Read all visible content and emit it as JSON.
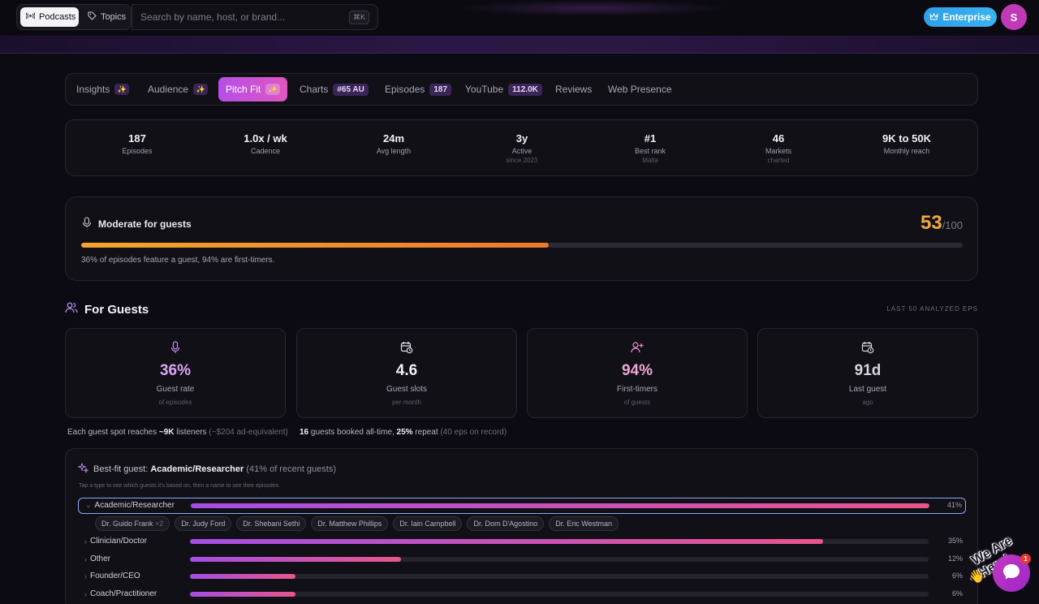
{
  "topbar": {
    "podcasts_label": "Podcasts",
    "topics_label": "Topics",
    "search_placeholder": "Search by name, host, or brand...",
    "search_shortcut": "⌘K",
    "enterprise_label": "Enterprise",
    "avatar_initial": "S"
  },
  "tabs": [
    {
      "label": "Insights",
      "spark": "✨"
    },
    {
      "label": "Audience",
      "spark": "✨"
    },
    {
      "label": "Pitch Fit",
      "spark": "✨"
    },
    {
      "label": "Charts",
      "badge": "#65 AU"
    },
    {
      "label": "Episodes",
      "badge": "187"
    },
    {
      "label": "YouTube",
      "badge": "112.0K"
    },
    {
      "label": "Reviews"
    },
    {
      "label": "Web Presence"
    }
  ],
  "stats": [
    {
      "value": "187",
      "label": "Episodes",
      "sub": ""
    },
    {
      "value": "1.0x / wk",
      "label": "Cadence",
      "sub": ""
    },
    {
      "value": "24m",
      "label": "Avg length",
      "sub": ""
    },
    {
      "value": "3y",
      "label": "Active",
      "sub": "since 2023"
    },
    {
      "value": "#1",
      "label": "Best rank",
      "sub": "Malta"
    },
    {
      "value": "46",
      "label": "Markets",
      "sub": "charted"
    },
    {
      "value": "9K to 50K",
      "label": "Monthly reach",
      "sub": ""
    }
  ],
  "score": {
    "title": "Moderate for guests",
    "value": "53",
    "max": "/100",
    "fraction": 0.53,
    "note": "36% of episodes feature a guest, 94% are first-timers."
  },
  "guests": {
    "title": "For Guests",
    "right_label": "LAST 50 ANALYZED EPS",
    "cards": [
      {
        "value": "36%",
        "label": "Guest rate",
        "sub": "of episodes",
        "color": "#d9a7f2"
      },
      {
        "value": "4.6",
        "label": "Guest slots",
        "sub": "per month",
        "color": "#f2f1f6"
      },
      {
        "value": "94%",
        "label": "First-timers",
        "sub": "of guests",
        "color": "#eea6d6"
      },
      {
        "value": "91d",
        "label": "Last guest",
        "sub": "ago",
        "color": "#d6d4dd"
      }
    ],
    "note_left": {
      "a": "Each guest spot reaches ",
      "b": "~9K",
      "c": " listeners ",
      "d": "(~$204 ad-equivalent)"
    },
    "note_right": {
      "a": "16",
      "b": " guests booked all-time, ",
      "c": "25%",
      "d": " repeat ",
      "e": "(40 eps on record)"
    }
  },
  "bestfit": {
    "prefix": "Best-fit guest: ",
    "type": "Academic/Researcher",
    "suffix": " (41% of recent guests)",
    "hint": "Tap a type to see which guests it's based on, then a name to see their episodes.",
    "rows": [
      {
        "label": "Academic/Researcher",
        "pct_text": "41%",
        "fraction": 1.0
      },
      {
        "label": "Clinician/Doctor",
        "pct_text": "35%",
        "fraction": 0.857
      },
      {
        "label": "Other",
        "pct_text": "12%",
        "fraction": 0.286
      },
      {
        "label": "Founder/CEO",
        "pct_text": "6%",
        "fraction": 0.143
      },
      {
        "label": "Coach/Practitioner",
        "pct_text": "6%",
        "fraction": 0.143
      }
    ],
    "chips": [
      {
        "name": "Dr. Guido Frank",
        "count": "×2"
      },
      {
        "name": "Dr. Judy Ford",
        "count": ""
      },
      {
        "name": "Dr. Shebani Sethi",
        "count": ""
      },
      {
        "name": "Dr. Matthew Phillips",
        "count": ""
      },
      {
        "name": "Dr. Iain Campbell",
        "count": ""
      },
      {
        "name": "Dr. Dom D'Agostino",
        "count": ""
      },
      {
        "name": "Dr. Eric Westman",
        "count": ""
      }
    ]
  },
  "chat": {
    "tagline": "We Are Here!",
    "badge": "1"
  }
}
